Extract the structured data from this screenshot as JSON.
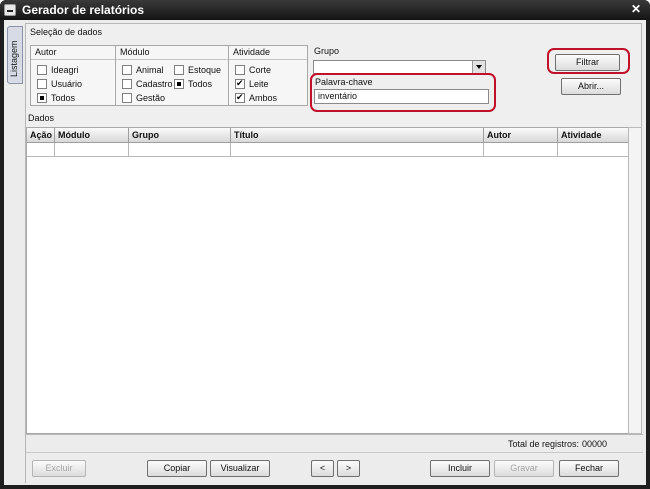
{
  "window": {
    "title": "Gerador de relatórios",
    "close_glyph": "✕"
  },
  "side_tab": {
    "label": "Listagem"
  },
  "selection": {
    "heading": "Seleção de dados",
    "autor": {
      "label": "Autor",
      "options": [
        {
          "label": "Ideagri",
          "state": "unchecked"
        },
        {
          "label": "Usuário",
          "state": "unchecked"
        },
        {
          "label": "Todos",
          "state": "filled"
        }
      ]
    },
    "modulo": {
      "label": "Módulo",
      "options": [
        {
          "label": "Animal",
          "state": "unchecked"
        },
        {
          "label": "Estoque",
          "state": "unchecked"
        },
        {
          "label": "Cadastro",
          "state": "unchecked"
        },
        {
          "label": "Todos",
          "state": "filled"
        },
        {
          "label": "Gestão",
          "state": "unchecked"
        }
      ]
    },
    "atividade": {
      "label": "Atividade",
      "options": [
        {
          "label": "Corte",
          "state": "unchecked"
        },
        {
          "label": "Leite",
          "state": "checked"
        },
        {
          "label": "Ambos",
          "state": "checked"
        }
      ]
    },
    "grupo": {
      "label": "Grupo",
      "value": ""
    },
    "palavra_chave": {
      "label": "Palavra-chave",
      "value": "inventário"
    },
    "filtrar_label": "Filtrar",
    "abrir_label": "Abrir..."
  },
  "dados": {
    "heading": "Dados",
    "columns": [
      "Ação",
      "Módulo",
      "Grupo",
      "Título",
      "Autor",
      "Atividade"
    ]
  },
  "status": {
    "total_label": "Total de registros:",
    "total_value": "00000"
  },
  "buttons": {
    "excluir": "Excluir",
    "copiar": "Copiar",
    "visualizar": "Visualizar",
    "prev": "<",
    "next": ">",
    "incluir": "Incluir",
    "gravar": "Gravar",
    "fechar": "Fechar"
  },
  "colors": {
    "highlight": "#c0102a",
    "titlebar": "#1e1e1e"
  }
}
